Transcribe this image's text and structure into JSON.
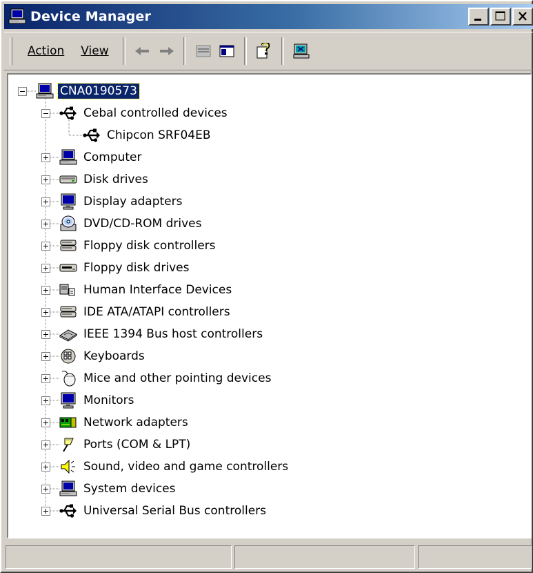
{
  "window": {
    "title": "Device Manager"
  },
  "toolbar": {
    "menus": [
      {
        "label": "Action"
      },
      {
        "label": "View"
      }
    ],
    "buttons": [
      "back-arrow-icon",
      "forward-arrow-icon",
      "properties-icon",
      "show-hide-tree-icon",
      "help-icon",
      "scan-hardware-icon"
    ]
  },
  "tree": {
    "root": {
      "label": "CNA0190573",
      "expanded": true,
      "selected": true,
      "icon": "computer-icon"
    },
    "nodes": [
      {
        "label": "Cebal controlled devices",
        "icon": "usb-icon",
        "expanded": true,
        "children": [
          {
            "label": "Chipcon SRF04EB",
            "icon": "usb-icon"
          }
        ]
      },
      {
        "label": "Computer",
        "icon": "computer-icon"
      },
      {
        "label": "Disk drives",
        "icon": "disk-drive-icon"
      },
      {
        "label": "Display adapters",
        "icon": "monitor-icon"
      },
      {
        "label": "DVD/CD-ROM drives",
        "icon": "cdrom-icon"
      },
      {
        "label": "Floppy disk controllers",
        "icon": "controller-icon"
      },
      {
        "label": "Floppy disk drives",
        "icon": "floppy-drive-icon"
      },
      {
        "label": "Human Interface Devices",
        "icon": "hid-icon"
      },
      {
        "label": "IDE ATA/ATAPI controllers",
        "icon": "controller-icon"
      },
      {
        "label": "IEEE 1394 Bus host controllers",
        "icon": "ieee1394-icon"
      },
      {
        "label": "Keyboards",
        "icon": "keyboard-icon"
      },
      {
        "label": "Mice and other pointing devices",
        "icon": "mouse-icon"
      },
      {
        "label": "Monitors",
        "icon": "monitor-icon"
      },
      {
        "label": "Network adapters",
        "icon": "network-adapter-icon"
      },
      {
        "label": "Ports (COM & LPT)",
        "icon": "port-icon"
      },
      {
        "label": "Sound, video and game controllers",
        "icon": "speaker-icon"
      },
      {
        "label": "System devices",
        "icon": "computer-icon"
      },
      {
        "label": "Universal Serial Bus controllers",
        "icon": "usb-icon"
      }
    ]
  },
  "statusbar": {
    "panes": [
      "",
      "",
      ""
    ]
  }
}
